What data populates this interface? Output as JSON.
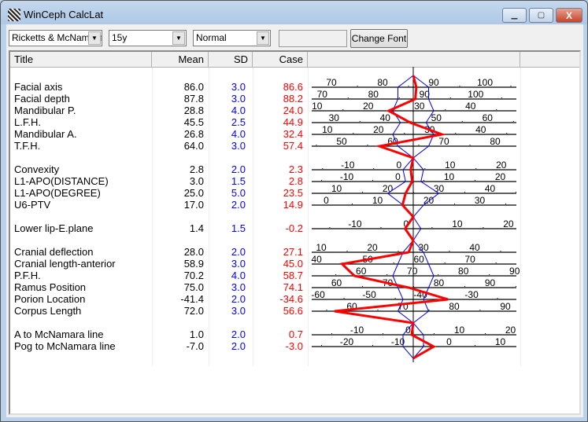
{
  "window": {
    "title": "WinCeph CalcLat",
    "minimize": "▁",
    "maximize": "▢",
    "close": "X"
  },
  "toolbar": {
    "analysis": "Ricketts & McNamara",
    "age": "15y",
    "mode": "Normal",
    "font_button": "Change Font"
  },
  "columns": {
    "title": "Title",
    "mean": "Mean",
    "sd": "SD",
    "case": "Case"
  },
  "colors": {
    "sd": "#0000ff",
    "case": "#ff0000",
    "sd_line": "#0000ff",
    "case_line": "#ff0000"
  },
  "rows": [
    {
      "blank": true
    },
    {
      "title": "Facial axis",
      "mean": "86.0",
      "sd": "3.0",
      "case": "86.6",
      "ticks": [
        70,
        80,
        90,
        100
      ]
    },
    {
      "title": "Facial depth",
      "mean": "87.8",
      "sd": "3.0",
      "case": "88.2",
      "ticks": [
        70,
        80,
        90,
        100
      ]
    },
    {
      "title": "Mandibular P.",
      "mean": "28.8",
      "sd": "4.0",
      "case": "24.0",
      "ticks": [
        10,
        20,
        30,
        40
      ]
    },
    {
      "title": "L.F.H.",
      "mean": "45.5",
      "sd": "2.5",
      "case": "44.9",
      "ticks": [
        30,
        40,
        50,
        60
      ]
    },
    {
      "title": "Mandibular A.",
      "mean": "26.8",
      "sd": "4.0",
      "case": "32.4",
      "ticks": [
        10,
        20,
        30,
        40
      ]
    },
    {
      "title": "T.F.H.",
      "mean": "64.0",
      "sd": "3.0",
      "case": "57.4",
      "ticks": [
        50,
        60,
        70,
        80
      ]
    },
    {
      "blank": true
    },
    {
      "title": "Convexity",
      "mean": "2.8",
      "sd": "2.0",
      "case": "2.3",
      "ticks": [
        -10,
        0,
        10,
        20
      ]
    },
    {
      "title": "L1-APO(DISTANCE)",
      "mean": "3.0",
      "sd": "1.5",
      "case": "2.8",
      "ticks": [
        -10,
        0,
        10,
        20
      ]
    },
    {
      "title": "L1-APO(DEGREE)",
      "mean": "25.0",
      "sd": "5.0",
      "case": "23.5",
      "ticks": [
        10,
        20,
        30,
        40
      ]
    },
    {
      "title": "U6-PTV",
      "mean": "17.0",
      "sd": "2.0",
      "case": "14.9",
      "ticks": [
        0,
        10,
        20,
        30
      ]
    },
    {
      "blank": true
    },
    {
      "title": "Lower lip-E.plane",
      "mean": "1.4",
      "sd": "1.5",
      "case": "-0.2",
      "ticks": [
        -10,
        0,
        10,
        20
      ]
    },
    {
      "blank": true
    },
    {
      "title": "Cranial deflection",
      "mean": "28.0",
      "sd": "2.0",
      "case": "27.1",
      "ticks": [
        10,
        20,
        30,
        40
      ]
    },
    {
      "title": "Cranial length-anterior",
      "mean": "58.9",
      "sd": "3.0",
      "case": "45.0",
      "ticks": [
        40,
        50,
        60,
        70
      ]
    },
    {
      "title": "P.F.H.",
      "mean": "70.2",
      "sd": "4.0",
      "case": "58.7",
      "ticks": [
        60,
        70,
        80,
        90
      ]
    },
    {
      "title": "Ramus Position",
      "mean": "75.0",
      "sd": "3.0",
      "case": "74.1",
      "ticks": [
        60,
        70,
        80,
        90
      ]
    },
    {
      "title": "Porion Location",
      "mean": "-41.4",
      "sd": "2.0",
      "case": "-34.6",
      "ticks": [
        -60,
        -50,
        -40,
        -30
      ]
    },
    {
      "title": "Corpus Length",
      "mean": "72.0",
      "sd": "3.0",
      "case": "56.6",
      "ticks": [
        60,
        70,
        80,
        90
      ]
    },
    {
      "blank": true
    },
    {
      "title": "A to McNamara line",
      "mean": "1.0",
      "sd": "2.0",
      "case": "0.7",
      "ticks": [
        -10,
        0,
        10,
        20
      ]
    },
    {
      "title": "Pog to McNamara line",
      "mean": "-7.0",
      "sd": "2.0",
      "case": "-3.0",
      "ticks": [
        -20,
        -10,
        0,
        10
      ]
    },
    {
      "blank": true
    }
  ]
}
